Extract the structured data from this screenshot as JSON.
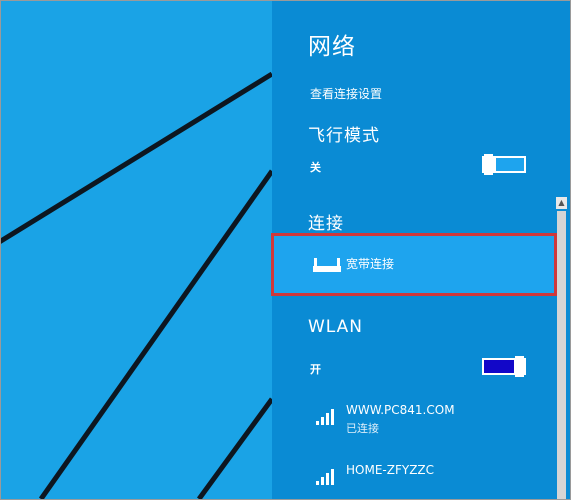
{
  "colors": {
    "desktop_bg": "#1aa3e6",
    "panel_bg": "#0a8bd4",
    "selected_item_bg": "#1ea4ee",
    "highlight_border": "#d0383a",
    "toggle_on_fill": "#1207c8",
    "toggle_off_fill": "#1ea4ee"
  },
  "panel": {
    "title": "网络",
    "view_settings_link": "查看连接设置"
  },
  "airplane_mode": {
    "heading": "飞行模式",
    "state_label": "关",
    "is_on": false
  },
  "connections": {
    "heading": "连接",
    "items": [
      {
        "label": "宽带连接",
        "icon": "wired-network-icon",
        "selected": true
      }
    ]
  },
  "wlan": {
    "heading": "WLAN",
    "state_label": "开",
    "is_on": true,
    "networks": [
      {
        "name": "WWW.PC841.COM",
        "status": "已连接",
        "icon": "wifi-signal-icon"
      },
      {
        "name": "HOME-ZFYZZC",
        "status": "",
        "icon": "wifi-signal-icon"
      }
    ]
  }
}
